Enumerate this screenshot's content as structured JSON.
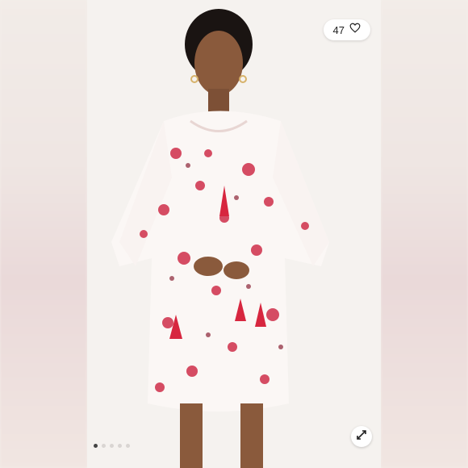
{
  "likes": {
    "count": "47",
    "icon": "heart-outline-icon"
  },
  "carousel": {
    "total_images": 5,
    "active_index": 0
  },
  "expand": {
    "icon": "expand-diagonal-icon"
  },
  "photo": {
    "description_icon": "product-photo"
  },
  "colors": {
    "accent": "#cf2f4a",
    "background": "#f5f3f1"
  }
}
